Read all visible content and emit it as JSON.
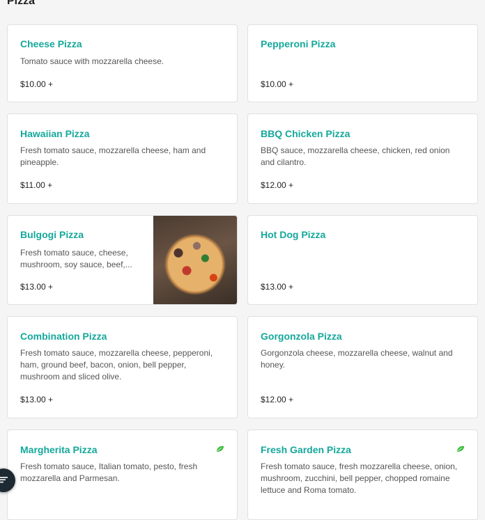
{
  "section": {
    "title": "Pizza"
  },
  "items": [
    {
      "name": "Cheese Pizza",
      "description": "Tomato sauce with mozzarella cheese.",
      "price": "$10.00 +"
    },
    {
      "name": "Pepperoni Pizza",
      "description": "",
      "price": "$10.00 +"
    },
    {
      "name": "Hawaiian Pizza",
      "description": "Fresh tomato sauce, mozzarella cheese, ham and pineapple.",
      "price": "$11.00 +"
    },
    {
      "name": "BBQ Chicken Pizza",
      "description": "BBQ sauce, mozzarella cheese, chicken, red onion and cilantro.",
      "price": "$12.00 +"
    },
    {
      "name": "Bulgogi Pizza",
      "description": "Fresh tomato sauce, cheese, mushroom, soy sauce, beef,...",
      "price": "$13.00 +"
    },
    {
      "name": "Hot Dog Pizza",
      "description": "",
      "price": "$13.00 +"
    },
    {
      "name": "Combination Pizza",
      "description": "Fresh tomato sauce, mozzarella cheese, pepperoni, ham, ground beef, bacon, onion, bell pepper, mushroom and sliced olive.",
      "price": "$13.00 +"
    },
    {
      "name": "Gorgonzola Pizza",
      "description": "Gorgonzola cheese, mozzarella cheese, walnut and honey.",
      "price": "$12.00 +"
    },
    {
      "name": "Margherita Pizza",
      "description": "Fresh tomato sauce, Italian tomato, pesto, fresh mozzarella and Parmesan.",
      "price": "",
      "icon": "vegetarian-leaf-icon"
    },
    {
      "name": "Fresh Garden Pizza",
      "description": "Fresh tomato sauce, fresh mozzarella cheese, onion, mushroom, zucchini, bell pepper, chopped romaine lettuce and Roma tomato.",
      "price": "",
      "icon": "vegetarian-leaf-icon"
    }
  ],
  "colors": {
    "accent": "#14a89b",
    "leaf": "#3dbb3d",
    "fab": "#1e2a33"
  },
  "fab": {
    "icon": "filter-icon"
  }
}
